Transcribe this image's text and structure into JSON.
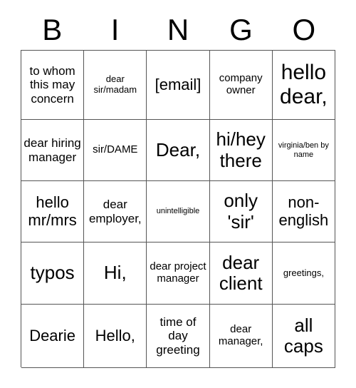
{
  "card": {
    "title": "BINGO",
    "header_letters": [
      "B",
      "I",
      "N",
      "G",
      "O"
    ],
    "columns": 5,
    "rows": 5,
    "border_color": "#555555",
    "text_color": "#000000",
    "background_color": "#ffffff",
    "cells": [
      {
        "text": "to whom this may concern",
        "size": "fs-lg"
      },
      {
        "text": "dear sir/madam",
        "size": "fs-sm"
      },
      {
        "text": "[email]",
        "size": "fs-xl"
      },
      {
        "text": "company owner",
        "size": "fs-md"
      },
      {
        "text": "hello dear,",
        "size": "fs-3xl"
      },
      {
        "text": "dear hiring manager",
        "size": "fs-lg"
      },
      {
        "text": "sir/DAME",
        "size": "fs-md"
      },
      {
        "text": "Dear,",
        "size": "fs-2xl"
      },
      {
        "text": "hi/hey there",
        "size": "fs-2xl"
      },
      {
        "text": "virginia/ben by name",
        "size": "fs-xs"
      },
      {
        "text": "hello mr/mrs",
        "size": "fs-xl"
      },
      {
        "text": "dear employer,",
        "size": "fs-lg"
      },
      {
        "text": "unintelligible",
        "size": "fs-xs"
      },
      {
        "text": "only 'sir'",
        "size": "fs-2xl"
      },
      {
        "text": "non-english",
        "size": "fs-xl"
      },
      {
        "text": "typos",
        "size": "fs-2xl"
      },
      {
        "text": "Hi,",
        "size": "fs-2xl"
      },
      {
        "text": "dear project manager",
        "size": "fs-md"
      },
      {
        "text": "dear client",
        "size": "fs-2xl"
      },
      {
        "text": "greetings,",
        "size": "fs-sm"
      },
      {
        "text": "Dearie",
        "size": "fs-xl"
      },
      {
        "text": "Hello,",
        "size": "fs-xl"
      },
      {
        "text": "time of day greeting",
        "size": "fs-lg"
      },
      {
        "text": "dear manager,",
        "size": "fs-md"
      },
      {
        "text": "all caps",
        "size": "fs-2xl"
      }
    ]
  }
}
